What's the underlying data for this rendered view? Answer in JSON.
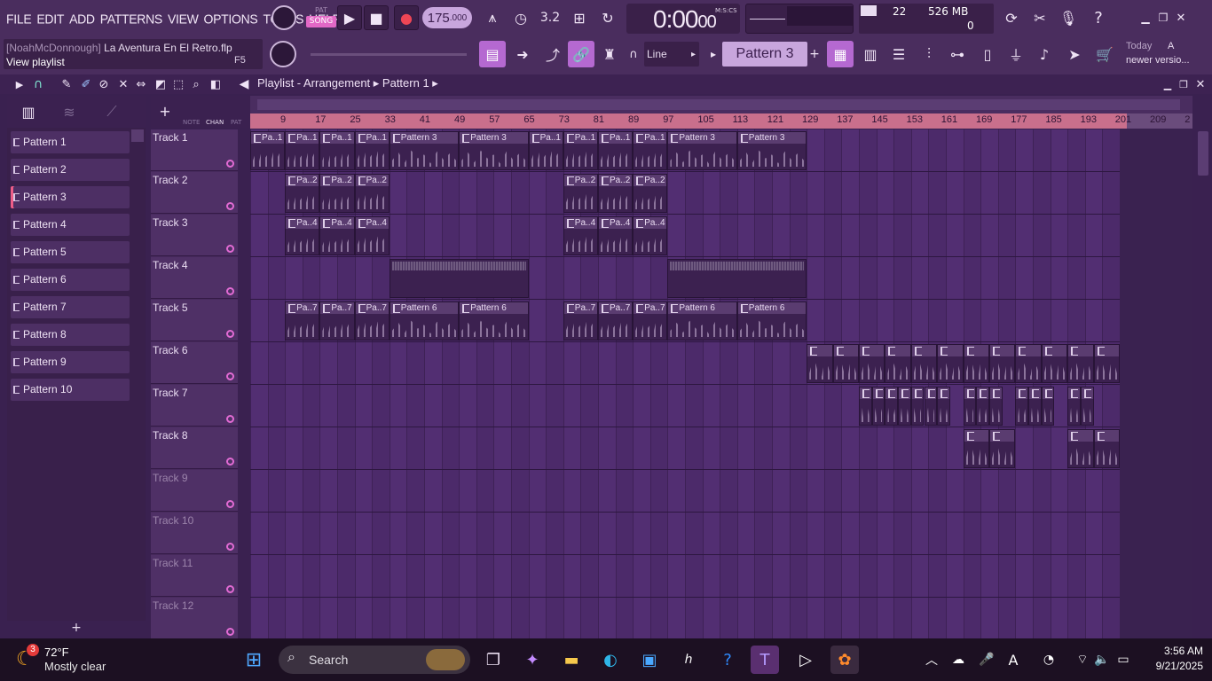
{
  "menu": [
    "FILE",
    "EDIT",
    "ADD",
    "PATTERNS",
    "VIEW",
    "OPTIONS",
    "TOOLS",
    "HELP"
  ],
  "transport": {
    "pat_label": "PAT",
    "song_label": "SONG",
    "tempo": "175",
    "tempo_decimal": ".000",
    "time": "0:00",
    "time_cs": "00",
    "time_unit": "M:S:CS",
    "step_label": "3.2"
  },
  "monitor": {
    "cpu": "22",
    "memory": "526 MB",
    "polyphony": "0"
  },
  "hint": {
    "user": "[NoahMcDonnough]",
    "file": "La Aventura En El Retro.flp",
    "action": "View playlist",
    "key": "F5"
  },
  "snap": {
    "value": "Line"
  },
  "pattern_selector": {
    "value": "Pattern 3"
  },
  "news": {
    "line1": "Today",
    "line2": "A",
    "line3": "newer versio..."
  },
  "playlist": {
    "title": "Playlist - Arrangement",
    "current_pattern": "Pattern 1",
    "picker_tabs": [
      "NOTE",
      "CHAN",
      "PAT"
    ],
    "patterns": [
      "Pattern 1",
      "Pattern 2",
      "Pattern 3",
      "Pattern 4",
      "Pattern 5",
      "Pattern 6",
      "Pattern 7",
      "Pattern 8",
      "Pattern 9",
      "Pattern 10"
    ],
    "add_symbol": "+",
    "ruler": [
      "9",
      "17",
      "25",
      "33",
      "41",
      "49",
      "57",
      "65",
      "73",
      "81",
      "89",
      "97",
      "105",
      "113",
      "121",
      "129",
      "137",
      "145",
      "153",
      "161",
      "169",
      "177",
      "185",
      "193",
      "201",
      "209",
      "2"
    ],
    "tracks": [
      "Track 1",
      "Track 2",
      "Track 3",
      "Track 4",
      "Track 5",
      "Track 6",
      "Track 7",
      "Track 8",
      "Track 9",
      "Track 10",
      "Track 11",
      "Track 12"
    ],
    "clips": [
      {
        "track": 0,
        "bar": 1,
        "len": 8,
        "label": "Pa..1"
      },
      {
        "track": 0,
        "bar": 9,
        "len": 8,
        "label": "Pa..1"
      },
      {
        "track": 0,
        "bar": 17,
        "len": 8,
        "label": "Pa..1"
      },
      {
        "track": 0,
        "bar": 25,
        "len": 8,
        "label": "Pa..1"
      },
      {
        "track": 0,
        "bar": 33,
        "len": 16,
        "label": "Pattern 3"
      },
      {
        "track": 0,
        "bar": 49,
        "len": 16,
        "label": "Pattern 3"
      },
      {
        "track": 0,
        "bar": 65,
        "len": 8,
        "label": "Pa..1"
      },
      {
        "track": 0,
        "bar": 73,
        "len": 8,
        "label": "Pa..1"
      },
      {
        "track": 0,
        "bar": 81,
        "len": 8,
        "label": "Pa..1"
      },
      {
        "track": 0,
        "bar": 89,
        "len": 8,
        "label": "Pa..1"
      },
      {
        "track": 0,
        "bar": 97,
        "len": 16,
        "label": "Pattern 3"
      },
      {
        "track": 0,
        "bar": 113,
        "len": 16,
        "label": "Pattern 3"
      },
      {
        "track": 1,
        "bar": 9,
        "len": 8,
        "label": "Pa..2"
      },
      {
        "track": 1,
        "bar": 17,
        "len": 8,
        "label": "Pa..2"
      },
      {
        "track": 1,
        "bar": 25,
        "len": 8,
        "label": "Pa..2"
      },
      {
        "track": 1,
        "bar": 73,
        "len": 8,
        "label": "Pa..2"
      },
      {
        "track": 1,
        "bar": 81,
        "len": 8,
        "label": "Pa..2"
      },
      {
        "track": 1,
        "bar": 89,
        "len": 8,
        "label": "Pa..2"
      },
      {
        "track": 2,
        "bar": 9,
        "len": 8,
        "label": "Pa..4"
      },
      {
        "track": 2,
        "bar": 17,
        "len": 8,
        "label": "Pa..4"
      },
      {
        "track": 2,
        "bar": 25,
        "len": 8,
        "label": "Pa..4"
      },
      {
        "track": 2,
        "bar": 73,
        "len": 8,
        "label": "Pa..4"
      },
      {
        "track": 2,
        "bar": 81,
        "len": 8,
        "label": "Pa..4"
      },
      {
        "track": 2,
        "bar": 89,
        "len": 8,
        "label": "Pa..4"
      },
      {
        "track": 3,
        "bar": 33,
        "len": 32,
        "label": "",
        "auto": true
      },
      {
        "track": 3,
        "bar": 97,
        "len": 32,
        "label": "",
        "auto": true
      },
      {
        "track": 4,
        "bar": 9,
        "len": 8,
        "label": "Pa..7"
      },
      {
        "track": 4,
        "bar": 17,
        "len": 8,
        "label": "Pa..7"
      },
      {
        "track": 4,
        "bar": 25,
        "len": 8,
        "label": "Pa..7"
      },
      {
        "track": 4,
        "bar": 33,
        "len": 16,
        "label": "Pattern 6"
      },
      {
        "track": 4,
        "bar": 49,
        "len": 16,
        "label": "Pattern 6"
      },
      {
        "track": 4,
        "bar": 73,
        "len": 8,
        "label": "Pa..7"
      },
      {
        "track": 4,
        "bar": 81,
        "len": 8,
        "label": "Pa..7"
      },
      {
        "track": 4,
        "bar": 89,
        "len": 8,
        "label": "Pa..7"
      },
      {
        "track": 4,
        "bar": 97,
        "len": 16,
        "label": "Pattern 6"
      },
      {
        "track": 4,
        "bar": 113,
        "len": 16,
        "label": "Pattern 6"
      },
      {
        "track": 5,
        "bar": 129,
        "len": 6,
        "label": ""
      },
      {
        "track": 5,
        "bar": 135,
        "len": 6,
        "label": ""
      },
      {
        "track": 5,
        "bar": 141,
        "len": 6,
        "label": ""
      },
      {
        "track": 5,
        "bar": 147,
        "len": 6,
        "label": ""
      },
      {
        "track": 5,
        "bar": 153,
        "len": 6,
        "label": ""
      },
      {
        "track": 5,
        "bar": 159,
        "len": 6,
        "label": ""
      },
      {
        "track": 5,
        "bar": 165,
        "len": 6,
        "label": ""
      },
      {
        "track": 5,
        "bar": 171,
        "len": 6,
        "label": ""
      },
      {
        "track": 5,
        "bar": 177,
        "len": 6,
        "label": ""
      },
      {
        "track": 5,
        "bar": 183,
        "len": 6,
        "label": ""
      },
      {
        "track": 5,
        "bar": 189,
        "len": 6,
        "label": ""
      },
      {
        "track": 5,
        "bar": 195,
        "len": 6,
        "label": ""
      },
      {
        "track": 6,
        "bar": 141,
        "len": 3,
        "label": ""
      },
      {
        "track": 6,
        "bar": 144,
        "len": 3,
        "label": ""
      },
      {
        "track": 6,
        "bar": 147,
        "len": 3,
        "label": ""
      },
      {
        "track": 6,
        "bar": 150,
        "len": 3,
        "label": ""
      },
      {
        "track": 6,
        "bar": 153,
        "len": 3,
        "label": ""
      },
      {
        "track": 6,
        "bar": 156,
        "len": 3,
        "label": ""
      },
      {
        "track": 6,
        "bar": 159,
        "len": 3,
        "label": ""
      },
      {
        "track": 6,
        "bar": 165,
        "len": 3,
        "label": ""
      },
      {
        "track": 6,
        "bar": 168,
        "len": 3,
        "label": ""
      },
      {
        "track": 6,
        "bar": 171,
        "len": 3,
        "label": ""
      },
      {
        "track": 6,
        "bar": 177,
        "len": 3,
        "label": ""
      },
      {
        "track": 6,
        "bar": 180,
        "len": 3,
        "label": ""
      },
      {
        "track": 6,
        "bar": 183,
        "len": 3,
        "label": ""
      },
      {
        "track": 6,
        "bar": 189,
        "len": 3,
        "label": ""
      },
      {
        "track": 6,
        "bar": 192,
        "len": 3,
        "label": ""
      },
      {
        "track": 7,
        "bar": 165,
        "len": 6,
        "label": ""
      },
      {
        "track": 7,
        "bar": 171,
        "len": 6,
        "label": ""
      },
      {
        "track": 7,
        "bar": 189,
        "len": 6,
        "label": ""
      },
      {
        "track": 7,
        "bar": 195,
        "len": 6,
        "label": ""
      }
    ]
  },
  "taskbar": {
    "weather_temp": "72°F",
    "weather_desc": "Mostly clear",
    "weather_badge": "3",
    "search_placeholder": "Search",
    "time": "3:56 AM",
    "date": "9/21/2025"
  },
  "colors": {
    "accent": "#b569d1",
    "ruler": "#c96f8c",
    "clip_header": "#5a3c70",
    "grid": "#4c2a6a"
  }
}
